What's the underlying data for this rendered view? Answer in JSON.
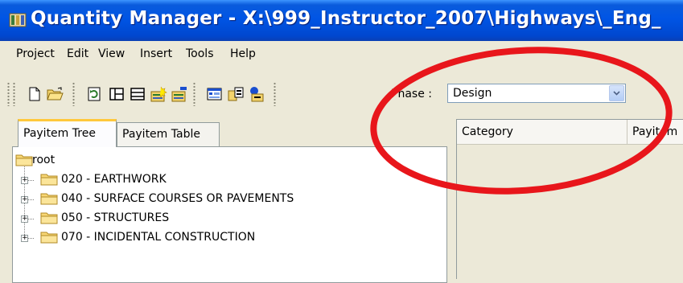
{
  "window": {
    "title": "Quantity Manager - X:\\999_Instructor_2007\\Highways\\_Eng_",
    "icon": "quantity-manager-app-icon",
    "title_bar_color": "#0055e5"
  },
  "menu": {
    "items": [
      "Project",
      "Edit",
      "View",
      "Insert",
      "Tools",
      "Help"
    ]
  },
  "toolbar": {
    "buttons": [
      {
        "icon": "new-document-icon"
      },
      {
        "icon": "open-folder-icon"
      },
      {
        "icon": "refresh-icon"
      },
      {
        "icon": "split-pane-icon"
      },
      {
        "icon": "list-view-icon"
      },
      {
        "icon": "add-item-icon"
      },
      {
        "icon": "remove-item-icon"
      },
      {
        "icon": "report-icon"
      },
      {
        "icon": "export-icon"
      },
      {
        "icon": "import-icon"
      }
    ],
    "phase_label": "Phase :",
    "phase_value": "Design"
  },
  "left_panel": {
    "tabs": [
      "Payitem Tree",
      "Payitem Table"
    ],
    "active_tab": "Payitem Tree",
    "tree": {
      "root": "root",
      "children": [
        "020 - EARTHWORK",
        "040 - SURFACE COURSES OR PAVEMENTS",
        "050 - STRUCTURES",
        "070 - INCIDENTAL CONSTRUCTION"
      ]
    }
  },
  "right_panel": {
    "columns": [
      "Category",
      "Payitem"
    ]
  },
  "annotation": {
    "shape": "ellipse",
    "color": "#e8161b"
  }
}
